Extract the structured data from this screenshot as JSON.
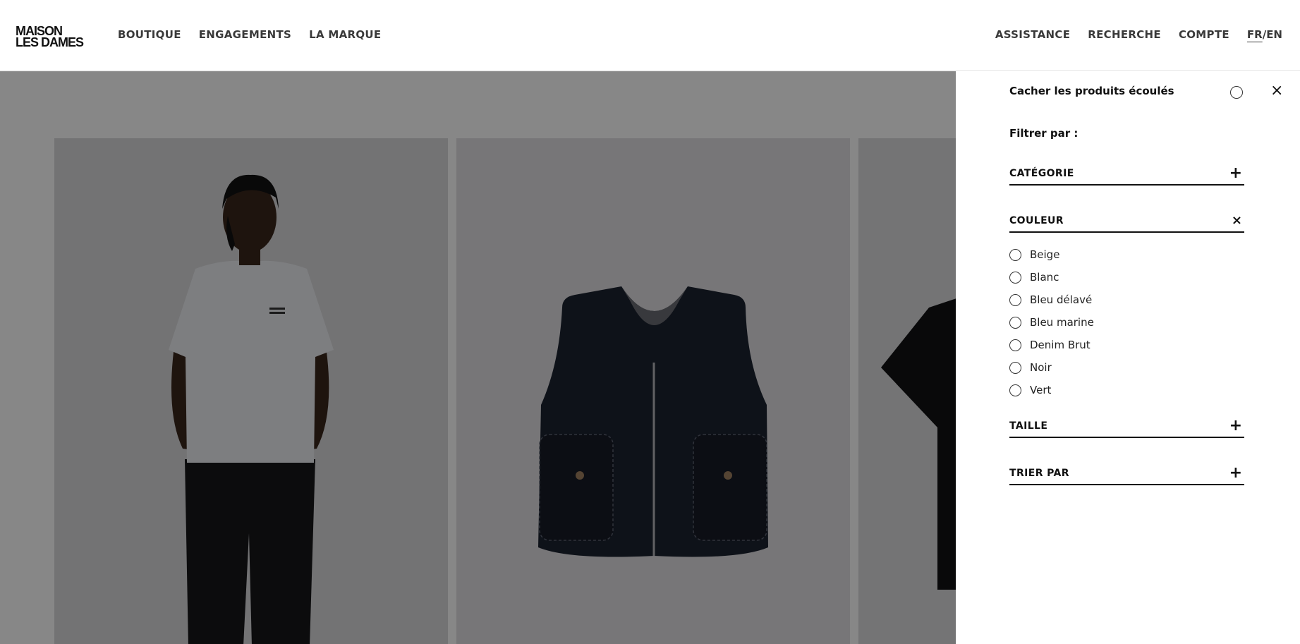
{
  "brand": {
    "line1": "MAISON",
    "line2": "LES DAMES"
  },
  "nav": {
    "left": [
      "BOUTIQUE",
      "ENGAGEMENTS",
      "LA MARQUE"
    ],
    "right": [
      "ASSISTANCE",
      "RECHERCHE",
      "COMPTE"
    ],
    "lang_fr": "FR",
    "lang_sep": "/",
    "lang_en": "EN"
  },
  "filter_panel": {
    "hide_sold_out_label": "Cacher les produits écoulés",
    "hide_sold_out_checked": false,
    "filter_by_label": "Filtrer par :",
    "sections": [
      {
        "title": "CATÉGORIE",
        "expanded": false,
        "toggle_icon": "+"
      },
      {
        "title": "COULEUR",
        "expanded": true,
        "toggle_icon": "×"
      },
      {
        "title": "TAILLE",
        "expanded": false,
        "toggle_icon": "+"
      },
      {
        "title": "TRIER PAR",
        "expanded": false,
        "toggle_icon": "+"
      }
    ],
    "colors": [
      "Beige",
      "Blanc",
      "Bleu délavé",
      "Bleu marine",
      "Denim Brut",
      "Noir",
      "Vert"
    ],
    "close_icon": "×"
  },
  "products": [
    {
      "image": "model wearing grey t-shirt and black trousers"
    },
    {
      "image": "raw denim zip vest"
    },
    {
      "image": "black shirt (partially visible)"
    }
  ]
}
